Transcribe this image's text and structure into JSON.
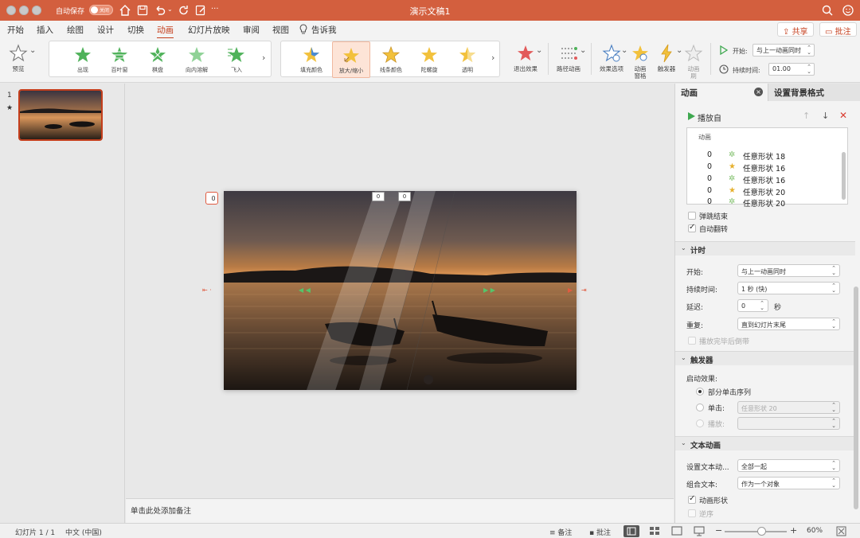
{
  "titlebar": {
    "autosave_label": "自动保存",
    "autosave_state": "关闭",
    "doc_title": "演示文稿1"
  },
  "menu": {
    "tabs": [
      "开始",
      "插入",
      "绘图",
      "设计",
      "切换",
      "动画",
      "幻灯片放映",
      "审阅",
      "视图"
    ],
    "active_tab": "动画",
    "tell_me": "告诉我",
    "share": "共享",
    "comment": "批注"
  },
  "ribbon": {
    "preview": "预览",
    "entrance_effects": [
      "出现",
      "百叶窗",
      "棋盘",
      "向内溶解",
      "飞入"
    ],
    "emphasis_effects": [
      "填充颜色",
      "放大/缩小",
      "线条颜色",
      "陀螺旋",
      "透明"
    ],
    "selected_effect": "放大/缩小",
    "exit_effects": "退出效果",
    "motion_paths": "路径动画",
    "effect_options": "效果选项",
    "animation_pane": "动画\n窗格",
    "trigger": "触发器",
    "animate_brush": "动画\n刷",
    "start_label": "开始:",
    "start_value": "与上一动画同时",
    "duration_label": "持续时间:",
    "duration_value": "01.00"
  },
  "thumbnails": {
    "slide_number": "1",
    "star": "★"
  },
  "slide": {
    "tags": [
      "0",
      "0",
      "0"
    ]
  },
  "notes_placeholder": "单击此处添加备注",
  "panel": {
    "tab_animation": "动画",
    "tab_format": "设置背景格式",
    "play_from": "播放自",
    "list_header": "动画",
    "items": [
      {
        "order": "0",
        "name": "任意形状 18",
        "kind": "multi"
      },
      {
        "order": "0",
        "name": "任意形状 16",
        "kind": "gold"
      },
      {
        "order": "0",
        "name": "任意形状 16",
        "kind": "multi"
      },
      {
        "order": "0",
        "name": "任意形状 20",
        "kind": "gold"
      },
      {
        "order": "0",
        "name": "任意形状 20",
        "kind": "multi"
      }
    ],
    "bounce_end": "弹跳结束",
    "auto_reverse": "自动翻转",
    "timing_title": "计时",
    "start_label": "开始:",
    "start_value": "与上一动画同时",
    "duration_label": "持续时间:",
    "duration_value": "1 秒 (快)",
    "delay_label": "延迟:",
    "delay_value": "0",
    "delay_unit": "秒",
    "repeat_label": "重复:",
    "repeat_value": "直到幻灯片末尾",
    "rewind_label": "播放完毕后倒带",
    "trigger_title": "触发器",
    "start_effect_label": "启动效果:",
    "trigger_seq": "部分单击序列",
    "trigger_click_label": "单击:",
    "trigger_click_value": "任意形状 20",
    "trigger_play_label": "播放:",
    "text_anim_title": "文本动画",
    "set_text_label": "设置文本动...",
    "set_text_value": "全部一起",
    "group_text_label": "组合文本:",
    "group_text_value": "作为一个对象",
    "animate_shape": "动画形状",
    "reverse_order": "逆序"
  },
  "statusbar": {
    "slide_info": "幻灯片 1 / 1",
    "language": "中文 (中国)",
    "notes": "备注",
    "comments": "批注",
    "zoom": "60%"
  },
  "colors": {
    "accent": "#c43e1c",
    "titlebar": "#d35f3e",
    "play_green": "#3ea84f"
  },
  "zoom_slider_fraction": 0.6
}
